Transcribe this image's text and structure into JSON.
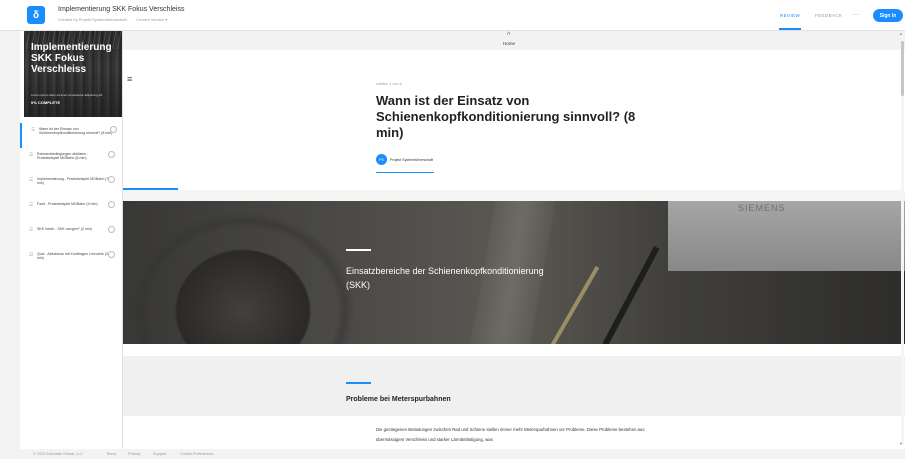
{
  "header": {
    "logo_glyph": "δ",
    "title": "Implementierung SKK Fokus Verschleiss",
    "subtitle_created": "Created by Projekt Systemführerschaft",
    "subtitle_sep": "·",
    "subtitle_version": "Current Version ▾",
    "tab_review": "REVIEW",
    "tab_feedback": "FEEDBACK",
    "more": "···",
    "signin": "Sign In"
  },
  "sidebar": {
    "hero_title": "Implementierung SKK Fokus Verschleiss",
    "hero_desc": "Lorem ipsum dolor sit amet consectetur adipiscing elit",
    "progress": "0% COMPLETE",
    "lessons": [
      {
        "icon": "☰",
        "label": "Wann ist der Einsatz von Schienenkopfkonditionierung sinnvoll? (8 min)"
      },
      {
        "icon": "☰",
        "label": "Rahmenbedingungen abklären - Praxisbeispiel MGBahn (8 min)"
      },
      {
        "icon": "☰",
        "label": "Implementierung - Praxisbeispiel MGBahn (7 min)"
      },
      {
        "icon": "☰",
        "label": "Fazit - Praxisbeispiel MGBahn (3 min)"
      },
      {
        "icon": "☰",
        "label": "SKK heute - SKK morgen? (2 min)"
      },
      {
        "icon": "☑",
        "label": "Quiz - Abschluss mit Kontfragen Lernziele (3 min)"
      }
    ]
  },
  "main": {
    "home_caret": "^",
    "home_label": "Home",
    "menu_icon": "≡",
    "lesson_count": "Lektion 1 von 6",
    "lesson_title": "Wann ist der Einsatz von Schienenkopfkonditionierung sinnvoll? (8 min)",
    "author_initials": "PS",
    "author_name": "Projekt Systemführerschaft",
    "hero_panel_text": "SIEMENS",
    "hero_title": "Einsatzbereiche der Schienenkopfkonditionierung (SKK)",
    "section_title": "Probleme bei Meterspurbahnen",
    "section_body": "Die gestiegenen Belastungen zwischen Rad und Schiene stellen immer mehr Meterspurbahnen vor Probleme. Diese Probleme bestehen aus übermässigem Verschleiss und starker Lärmbelästigung, was"
  },
  "footer": {
    "copyright": "© 2023 Articulate Global, LLC",
    "terms": "Terms",
    "privacy": "Privacy",
    "support": "Support",
    "cookies": "Cookie Preferences"
  },
  "colors": {
    "accent": "#1a8dff"
  }
}
